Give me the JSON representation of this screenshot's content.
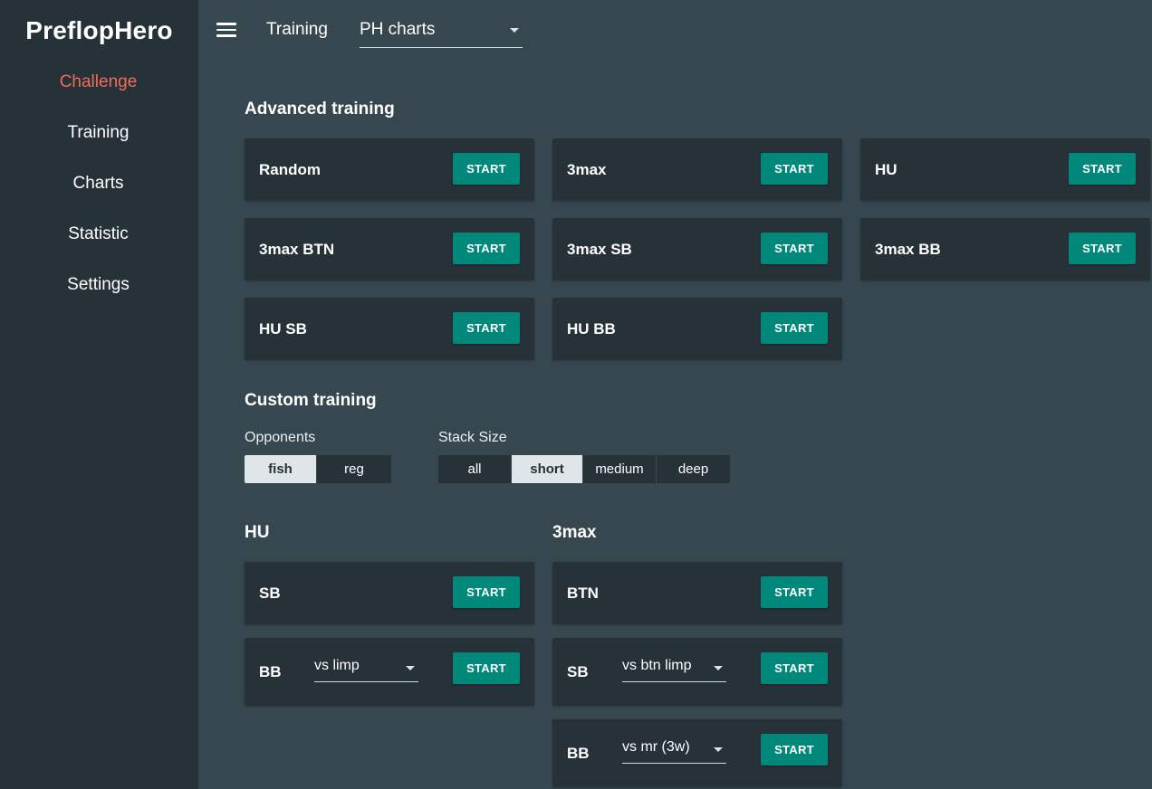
{
  "app": {
    "logo": "PreflopHero"
  },
  "sidebar": {
    "items": [
      {
        "label": "Challenge",
        "active": true
      },
      {
        "label": "Training"
      },
      {
        "label": "Charts"
      },
      {
        "label": "Statistic"
      },
      {
        "label": "Settings"
      }
    ]
  },
  "topbar": {
    "menu_icon": "hamburger-menu-icon",
    "title": "Training",
    "chart_select": {
      "value": "PH charts"
    }
  },
  "advanced": {
    "title": "Advanced training",
    "cards": [
      {
        "label": "Random",
        "button": "START"
      },
      {
        "label": "3max",
        "button": "START"
      },
      {
        "label": "HU",
        "button": "START"
      },
      {
        "label": "3max BTN",
        "button": "START"
      },
      {
        "label": "3max SB",
        "button": "START"
      },
      {
        "label": "3max BB",
        "button": "START"
      },
      {
        "label": "HU SB",
        "button": "START"
      },
      {
        "label": "HU BB",
        "button": "START"
      }
    ]
  },
  "custom": {
    "title": "Custom training",
    "opponents": {
      "label": "Opponents",
      "options": [
        "fish",
        "reg"
      ],
      "selected": "fish"
    },
    "stack_size": {
      "label": "Stack Size",
      "options": [
        "all",
        "short",
        "medium",
        "deep"
      ],
      "selected": "short"
    },
    "hu": {
      "title": "HU",
      "sb": {
        "label": "SB",
        "button": "START"
      },
      "bb": {
        "label": "BB",
        "select": "vs limp",
        "button": "START"
      }
    },
    "threemax": {
      "title": "3max",
      "btn": {
        "label": "BTN",
        "button": "START"
      },
      "sb": {
        "label": "SB",
        "select": "vs btn limp",
        "button": "START"
      },
      "bb": {
        "label": "BB",
        "select": "vs mr (3w)",
        "button": "START"
      }
    }
  },
  "colors": {
    "background": "#37474f",
    "sidebar": "#263238",
    "card": "#263238",
    "accent_button": "#00897b",
    "active_nav": "#ef6c5a",
    "selected_toggle": "#dfe5e8"
  }
}
